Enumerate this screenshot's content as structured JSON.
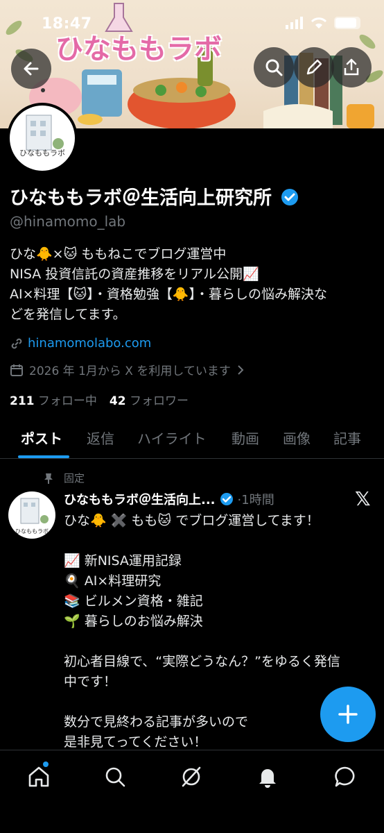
{
  "status_bar": {
    "time": "18:47"
  },
  "banner": {
    "title": "ひなももラボ"
  },
  "profile": {
    "avatar_label": "ひなももラボ",
    "name": "ひなももラボ＠生活向上研究所",
    "handle": "@hinamomo_lab",
    "bio_lines": [
      "ひな🐥×🐱 ももねこでブログ運営中",
      "NISA 投資信託の資産推移をリアル公開📈",
      "AI×料理【🐱】・資格勉強【🐥】・暮らしの悩み解決な",
      "どを発信してます。"
    ],
    "link": "hinamomolabo.com",
    "joined": "2026 年 1月から X を利用しています",
    "following_count": "211",
    "following_label": "フォロー中",
    "followers_count": "42",
    "followers_label": "フォロワー"
  },
  "tabs": [
    "ポスト",
    "返信",
    "ハイライト",
    "動画",
    "画像",
    "記事"
  ],
  "post": {
    "pinned_label": "固定",
    "author": "ひなももラボ＠生活向上...",
    "time": "·1時間",
    "lines": [
      "ひな🐥 ✖️ もも🐱 でブログ運営してます！",
      "",
      "📈 新NISA運用記録",
      "🍳 AI×料理研究",
      "📚 ビルメン資格・雑記",
      "🌱 暮らしのお悩み解決",
      "",
      "初心者目線で、“実際どうなん？”をゆるく発信",
      "中です！",
      "",
      "数分で見終わる記事が多いので",
      "是非見てってください！"
    ]
  },
  "colors": {
    "accent": "#1d9bf0",
    "background": "#000000",
    "muted": "#71767b"
  }
}
